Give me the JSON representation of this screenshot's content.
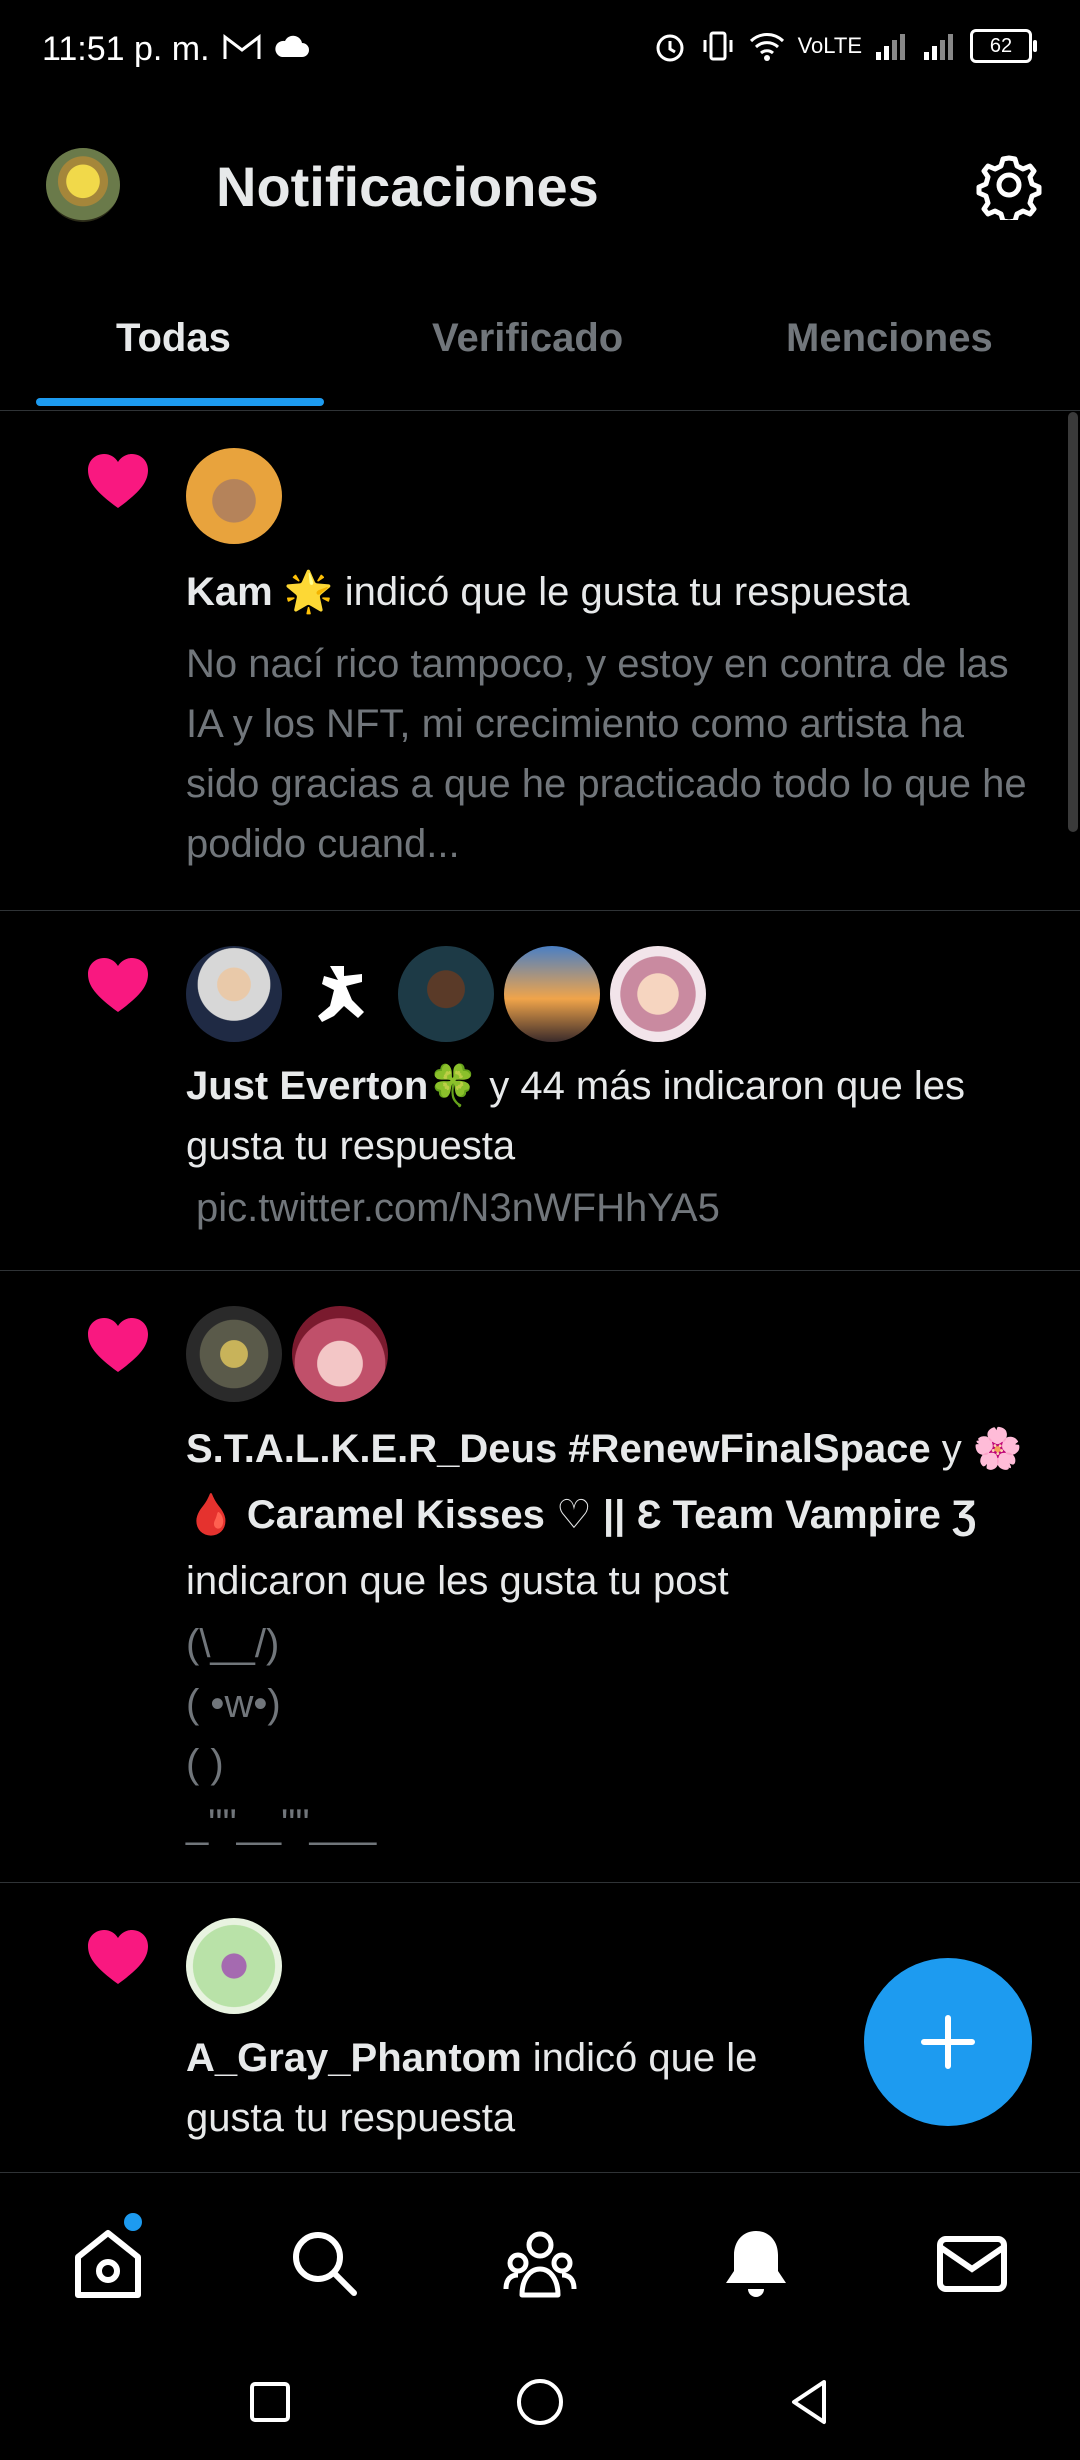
{
  "status_bar": {
    "time": "11:51 p. m.",
    "network": "VoLTE",
    "battery": "62"
  },
  "header": {
    "title": "Notificaciones"
  },
  "tabs": [
    {
      "label": "Todas",
      "active": true
    },
    {
      "label": "Verificado",
      "active": false
    },
    {
      "label": "Menciones",
      "active": false
    }
  ],
  "notifications": [
    {
      "user": "Kam 🌟",
      "action": " indicó que le gusta tu respuesta",
      "preview": "No nací rico tampoco, y estoy en contra de las IA y los NFT, mi crecimiento como artista ha sido gracias a que he practicado todo lo que he podido cuand..."
    },
    {
      "user": "Just Everton🍀",
      "action": " y 44 más indicaron que les gusta tu respuesta",
      "preview": "pic.twitter.com/N3nWFHhYA5"
    },
    {
      "user": "S.T.A.L.K.E.R_Deus #RenewFinalSpace",
      "connector": " y ",
      "user2": "🌸🩸 Caramel Kisses ♡ || Ɛ Team Vampire Ʒ",
      "action": " indicaron que les gusta tu post",
      "preview": "(\\__/)\n( •w•)\n(      )\n_\"\"__\"\"___"
    },
    {
      "user": "A_Gray_Phantom",
      "action": " indicó que le gusta tu respuesta"
    }
  ],
  "colors": {
    "accent": "#1d9bf0",
    "like": "#f91880",
    "muted": "#71767b"
  },
  "nav_icons": [
    "home-icon",
    "search-icon",
    "communities-icon",
    "notifications-icon",
    "messages-icon"
  ]
}
